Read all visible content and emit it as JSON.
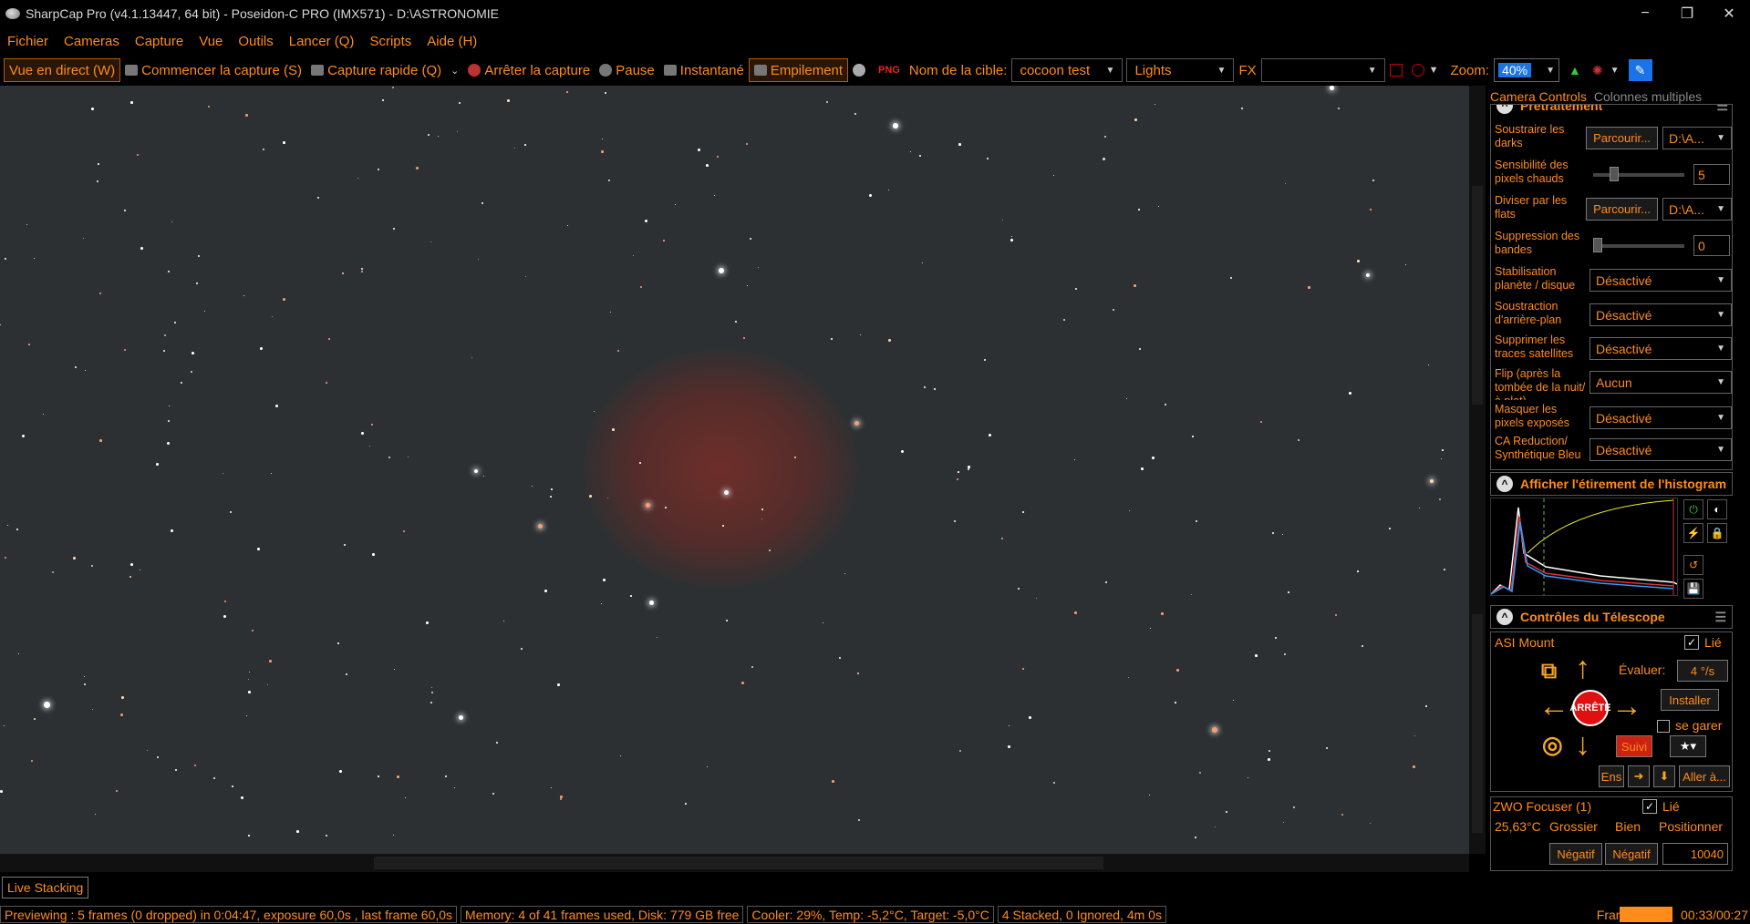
{
  "window": {
    "title": "SharpCap Pro (v4.1.13447, 64 bit) - Poseidon-C PRO (IMX571) - D:\\ASTRONOMIE",
    "minimize": "−",
    "restore": "❐",
    "close": "✕"
  },
  "menu": [
    "Fichier",
    "Cameras",
    "Capture",
    "Vue",
    "Outils",
    "Lancer (Q)",
    "Scripts",
    "Aide (H)"
  ],
  "toolbar": {
    "live_view": "Vue en direct (W)",
    "start_capture": "Commencer la capture (S)",
    "quick_capture": "Capture rapide (Q)",
    "stop_capture": "Arrêter la capture",
    "pause": "Pause",
    "snapshot": "Instantané",
    "stacking": "Empilement",
    "target_label": "Nom de la cible:",
    "target_value": "cocoon test",
    "frame_type": "Lights",
    "fx_label": "FX",
    "fx_value": "",
    "zoom_label": "Zoom:",
    "zoom_value": "40%"
  },
  "panel": {
    "tab_camera": "Camera Controls",
    "tab_columns": "Colonnes multiples",
    "preprocessing_title": "Prétraitement",
    "rows": [
      {
        "label": "Soustraire les darks",
        "button": "Parcourir...",
        "value": "D:\\A..."
      },
      {
        "label": "Sensibilité des pixels chauds",
        "slider": 0.2,
        "value": "5"
      },
      {
        "label": "Diviser par les flats",
        "button": "Parcourir...",
        "value": "D:\\A..."
      },
      {
        "label": "Suppression des bandes",
        "slider": 0.0,
        "value": "0"
      },
      {
        "label": "Stabilisation planète / disque",
        "value": "Désactivé"
      },
      {
        "label": "Soustraction d'arrière-plan",
        "value": "Désactivé"
      },
      {
        "label": "Supprimer les traces satellites",
        "value": "Désactivé"
      },
      {
        "label": "Flip (après la tombée de la nuit/à plat)",
        "value": "Aucun"
      },
      {
        "label": "Masquer les pixels exposés",
        "value": "Désactivé"
      },
      {
        "label": "CA Reduction/ Synthétique Bleu",
        "value": "Désactivé"
      }
    ],
    "histogram_title": "Afficher l'étirement de l'histogram",
    "telescope_title": "Contrôles du Télescope",
    "mount": {
      "name": "ASI Mount",
      "linked_label": "Lié",
      "rate_label": "Évaluer:",
      "rate_value": "4 °/s",
      "stop_label": "ARRÊTE",
      "install": "Installer",
      "park_label": "se garer",
      "track": "Suivi",
      "ens": "Ens",
      "goto": "Aller à..."
    },
    "focuser": {
      "name": "ZWO Focuser (1)",
      "linked_label": "Lié",
      "temp": "25,63°C",
      "coarse": "Grossier",
      "fine": "Bien",
      "position_label": "Positionner",
      "neg1": "Négatif",
      "neg2": "Négatif",
      "position_value": "10040"
    }
  },
  "live_stacking": "Live Stacking",
  "status": {
    "preview": "Previewing : 5 frames (0 dropped) in 0:04:47, exposure 60,0s , last frame 60,0s",
    "memory": "Memory: 4 of 41 frames used, Disk: 779 GB free",
    "cooler": "Cooler: 29%, Temp: -5,2°C, Target: -5,0°C",
    "stacked": "4 Stacked, 0 Ignored, 4m 0s",
    "frame_label": "Frame :",
    "frame_progress": 0.58,
    "frame_time": "00:33/00:27"
  },
  "colors": {
    "accent": "#ff8c1a",
    "sky": "#2c3032",
    "nebula": "#7a2e28"
  }
}
